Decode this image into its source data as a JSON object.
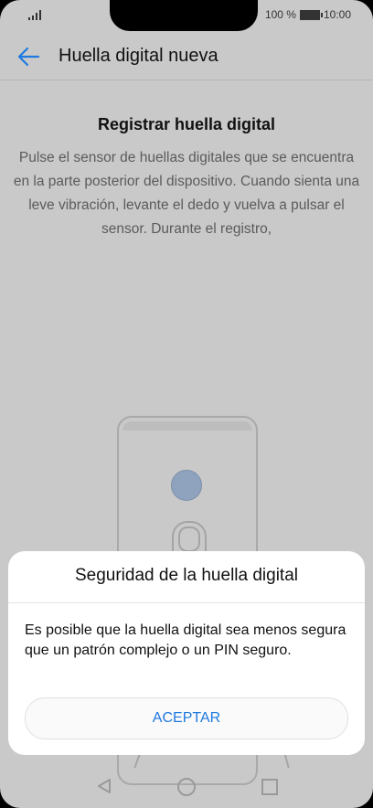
{
  "status_bar": {
    "battery_text": "100 %",
    "time": "10:00"
  },
  "app_bar": {
    "title": "Huella digital nueva"
  },
  "content": {
    "heading": "Registrar huella digital",
    "description": "Pulse el sensor de huellas digitales que se encuentra en la parte posterior del dispositivo. Cuando sienta una leve vibración, levante el dedo y vuelva a pulsar el sensor. Durante el registro,"
  },
  "dialog": {
    "title": "Seguridad de la huella digital",
    "message": "Es posible que la huella digital sea menos segura que un patrón complejo o un PIN seguro.",
    "accept_label": "ACEPTAR"
  },
  "colors": {
    "accent": "#1f7ae0",
    "overlay": "#c9c9c9",
    "sensor": "#8fa3bf"
  }
}
